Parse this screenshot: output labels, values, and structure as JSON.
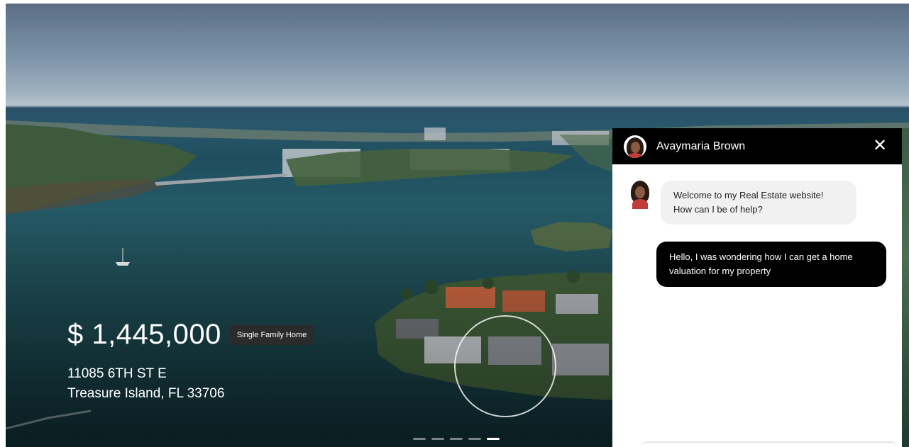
{
  "listing": {
    "price": "$ 1,445,000",
    "property_type": "Single Family Home",
    "address_line1": "11085 6TH ST E",
    "address_line2": "Treasure Island, FL 33706"
  },
  "slideshow": {
    "slide_count": 5,
    "active_index": 4
  },
  "chat": {
    "agent_name": "Avaymaria Brown",
    "close_icon": "close-icon",
    "messages": [
      {
        "from": "agent",
        "text": "Welcome to my Real Estate website! How can I be of help?"
      },
      {
        "from": "user",
        "text": "Hello, I was wondering how I can get a home valuation for my property"
      }
    ]
  },
  "colors": {
    "chat_header": "#000000",
    "agent_bubble": "#f1f1f1",
    "user_bubble": "#000000",
    "badge": "#2b2b2b"
  }
}
